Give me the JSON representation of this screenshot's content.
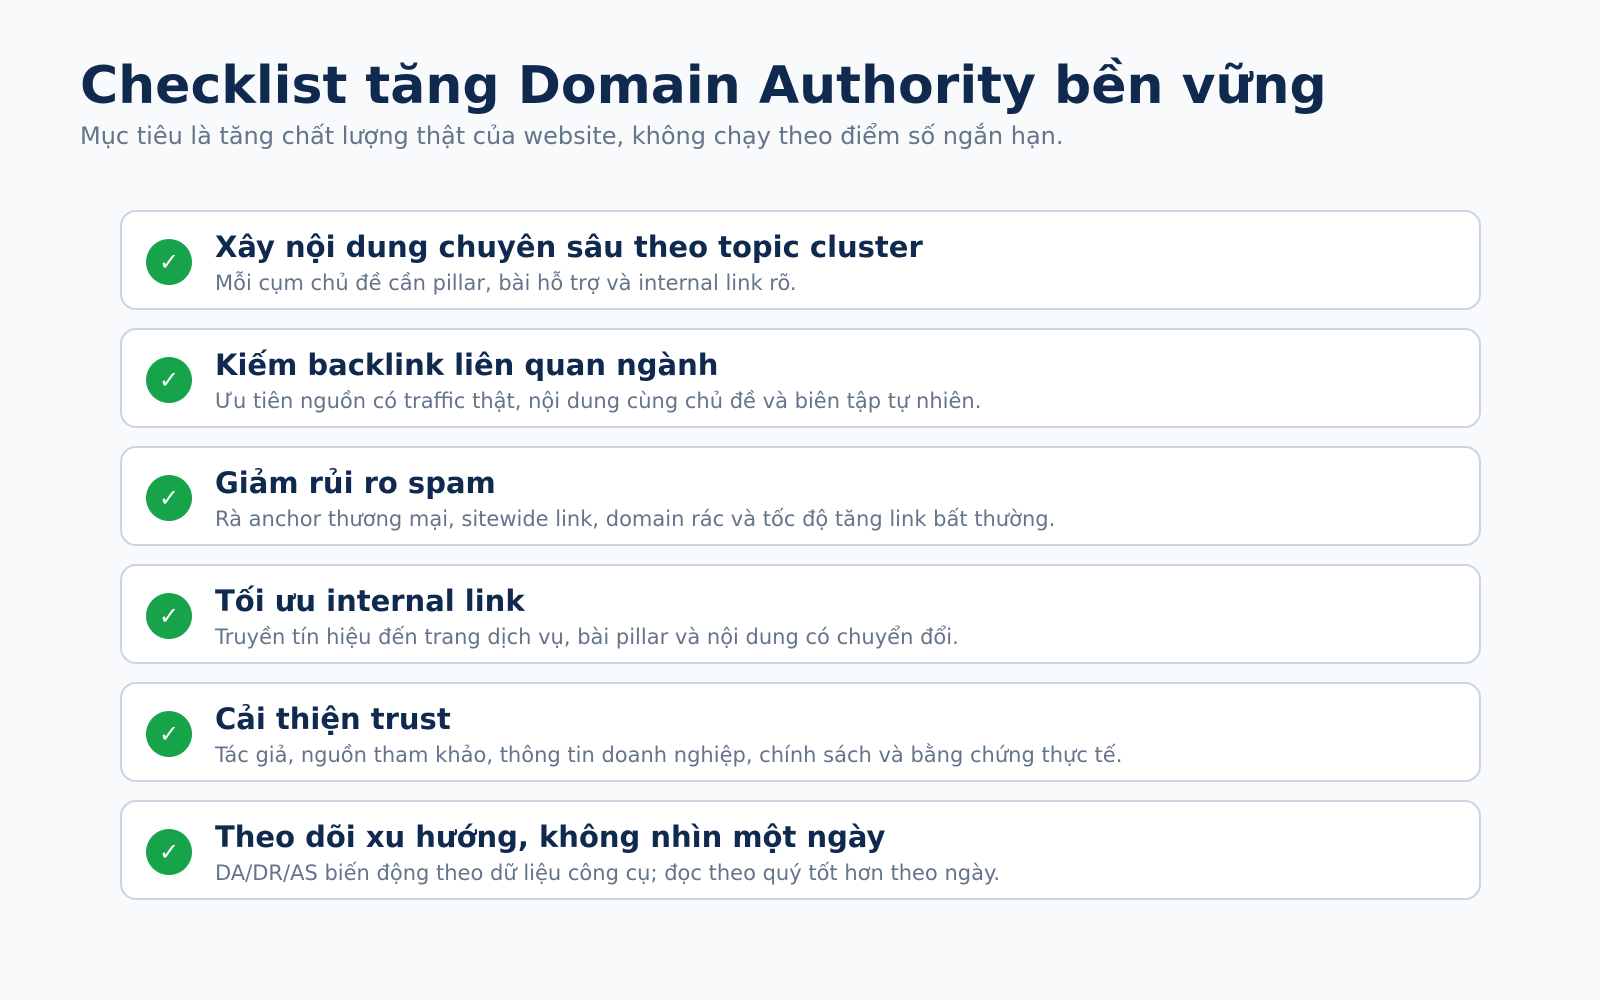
{
  "header": {
    "title": "Checklist tăng Domain Authority bền vững",
    "subtitle": "Mục tiêu là tăng chất lượng thật của website, không chạy theo điểm số ngắn hạn."
  },
  "check_icon": "check-icon",
  "colors": {
    "title": "#10294f",
    "muted": "#64748b",
    "check": "#16a34a",
    "card_border": "#cbd5e1",
    "background": "#f8fafc"
  },
  "checklist": [
    {
      "title": "Xây nội dung chuyên sâu theo topic cluster",
      "description": "Mỗi cụm chủ đề cần pillar, bài hỗ trợ và internal link rõ."
    },
    {
      "title": "Kiếm backlink liên quan ngành",
      "description": "Ưu tiên nguồn có traffic thật, nội dung cùng chủ đề và biên tập tự nhiên."
    },
    {
      "title": "Giảm rủi ro spam",
      "description": "Rà anchor thương mại, sitewide link, domain rác và tốc độ tăng link bất thường."
    },
    {
      "title": "Tối ưu internal link",
      "description": "Truyền tín hiệu đến trang dịch vụ, bài pillar và nội dung có chuyển đổi."
    },
    {
      "title": "Cải thiện trust",
      "description": "Tác giả, nguồn tham khảo, thông tin doanh nghiệp, chính sách và bằng chứng thực tế."
    },
    {
      "title": "Theo dõi xu hướng, không nhìn một ngày",
      "description": "DA/DR/AS biến động theo dữ liệu công cụ; đọc theo quý tốt hơn theo ngày."
    }
  ]
}
